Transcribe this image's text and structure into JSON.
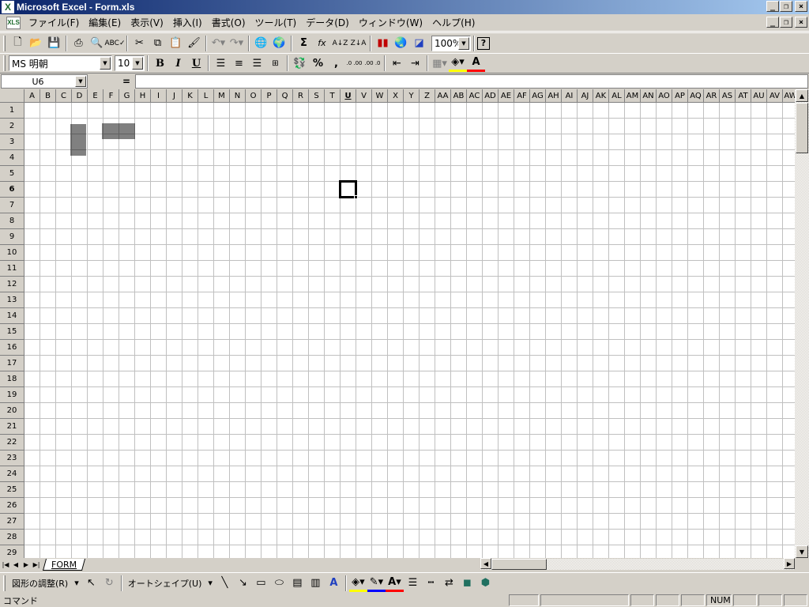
{
  "window": {
    "title": "Microsoft Excel - Form.xls",
    "app_icon": "excel-icon",
    "controls": {
      "minimize": "_",
      "restore": "❐",
      "close": "×"
    }
  },
  "menu": {
    "items": [
      {
        "label": "ファイル(F)"
      },
      {
        "label": "編集(E)"
      },
      {
        "label": "表示(V)"
      },
      {
        "label": "挿入(I)"
      },
      {
        "label": "書式(O)"
      },
      {
        "label": "ツール(T)"
      },
      {
        "label": "データ(D)"
      },
      {
        "label": "ウィンドウ(W)"
      },
      {
        "label": "ヘルプ(H)"
      }
    ]
  },
  "standard_toolbar": {
    "zoom": "100%",
    "buttons": [
      "new-icon",
      "open-icon",
      "save-icon",
      "print-icon",
      "print-preview-icon",
      "spelling-icon",
      "cut-icon",
      "copy-icon",
      "paste-icon",
      "format-painter-icon",
      "undo-icon",
      "redo-icon",
      "hyperlink-icon",
      "web-toolbar-icon",
      "autosum-icon",
      "function-icon",
      "sort-ascending-icon",
      "sort-descending-icon",
      "chart-wizard-icon",
      "map-icon",
      "drawing-icon",
      "help-icon"
    ],
    "labels": {
      "autosum": "Σ",
      "function": "fx"
    }
  },
  "formatting_toolbar": {
    "font": "MS 明朝",
    "size": "10",
    "bold": "B",
    "italic": "I",
    "underline": "U",
    "percent": "%",
    "comma": ",",
    "increase_decimal": ".0 .00",
    "decrease_decimal": ".00 .0",
    "font_color_label": "A"
  },
  "formula_bar": {
    "name_box": "U6",
    "equals": "=",
    "content": ""
  },
  "sheet": {
    "columns": [
      "A",
      "B",
      "C",
      "D",
      "E",
      "F",
      "G",
      "H",
      "I",
      "J",
      "K",
      "L",
      "M",
      "N",
      "O",
      "P",
      "Q",
      "R",
      "S",
      "T",
      "U",
      "V",
      "W",
      "X",
      "Y",
      "Z",
      "AA",
      "AB",
      "AC",
      "AD",
      "AE",
      "AF",
      "AG",
      "AH",
      "AI",
      "AJ",
      "AK",
      "AL",
      "AM",
      "AN",
      "AO",
      "AP",
      "AQ",
      "AR",
      "AS",
      "AT",
      "AU",
      "AV",
      "AW"
    ],
    "rows": [
      "1",
      "2",
      "3",
      "4",
      "5",
      "6",
      "7",
      "8",
      "9",
      "10",
      "11",
      "12",
      "13",
      "14",
      "15",
      "16",
      "17",
      "18",
      "19",
      "20",
      "21",
      "22",
      "23",
      "24",
      "25",
      "26",
      "27",
      "28",
      "29"
    ],
    "active_column": "U",
    "active_row": "6",
    "tab_name": "FORM"
  },
  "drawing_toolbar": {
    "adjust_label": "図形の調整(R)",
    "autoshape_label": "オートシェイプ(U)"
  },
  "status": {
    "text": "コマンド",
    "num": "NUM"
  }
}
